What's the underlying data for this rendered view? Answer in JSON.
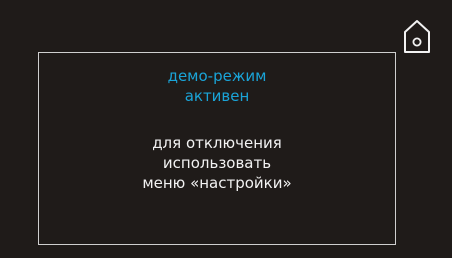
{
  "header": {
    "home_icon": "home-icon"
  },
  "message": {
    "status_lines": [
      "демо-режим",
      "активен"
    ],
    "instruction_lines": [
      "для отключения",
      "использовать",
      "меню «настройки»"
    ]
  },
  "colors": {
    "background": "#1f1b19",
    "accent": "#1aa4d8",
    "text": "#f2f2f2",
    "frame": "#cfcfcf"
  }
}
